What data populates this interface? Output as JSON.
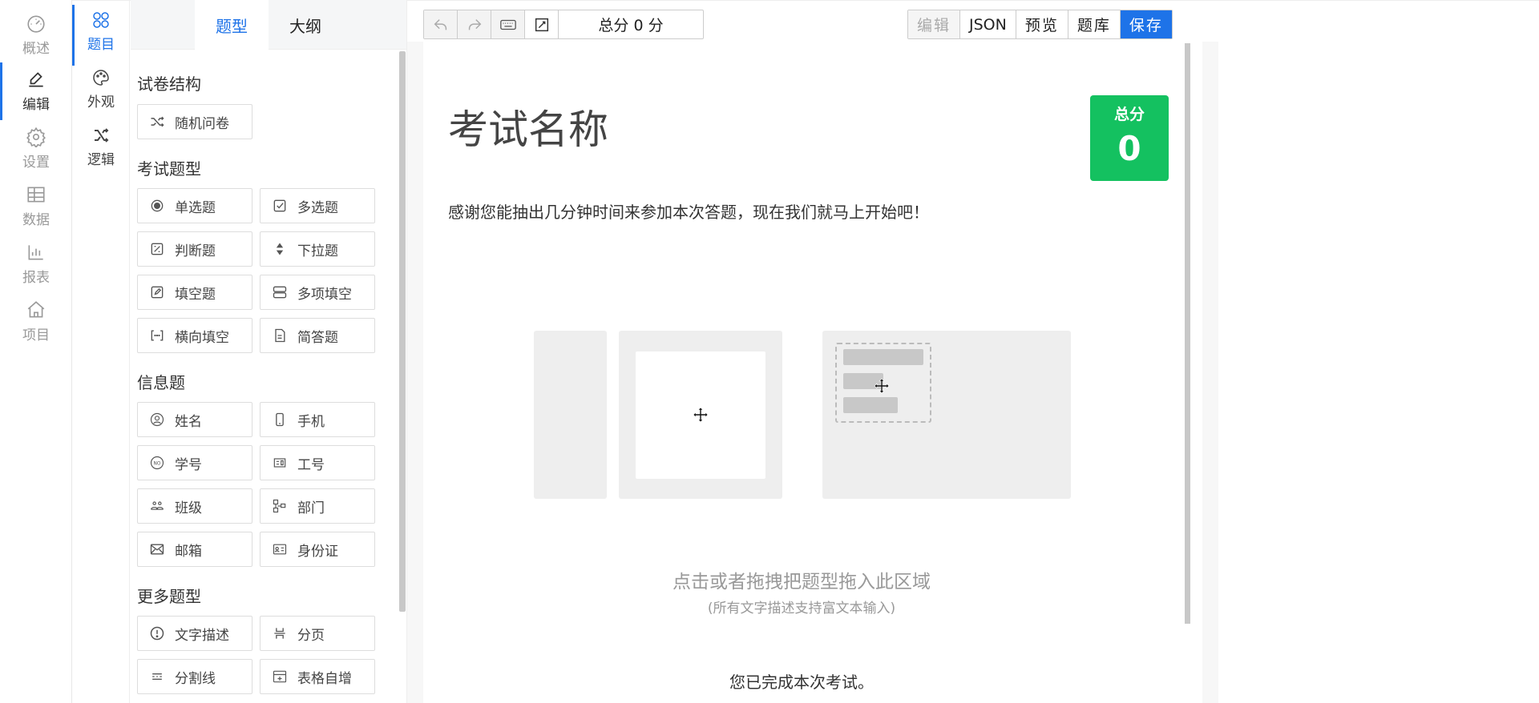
{
  "nav": {
    "items": [
      {
        "label": "概述",
        "icon": "dashboard-icon"
      },
      {
        "label": "编辑",
        "icon": "edit-icon"
      },
      {
        "label": "设置",
        "icon": "gear-icon"
      },
      {
        "label": "数据",
        "icon": "table-icon"
      },
      {
        "label": "报表",
        "icon": "bar-chart-icon"
      },
      {
        "label": "项目",
        "icon": "home-icon"
      }
    ]
  },
  "tools": {
    "items": [
      {
        "label": "题目",
        "icon": "questions-icon"
      },
      {
        "label": "外观",
        "icon": "palette-icon"
      },
      {
        "label": "逻辑",
        "icon": "shuffle-icon"
      }
    ]
  },
  "palette": {
    "tabs": [
      "题型",
      "大纲"
    ],
    "sections": {
      "structure": "试卷结构",
      "exam_types": "考试题型",
      "info": "信息题",
      "more": "更多题型"
    },
    "buttons": {
      "random_paper": "随机问卷",
      "single_choice": "单选题",
      "multi_choice": "多选题",
      "true_false": "判断题",
      "dropdown": "下拉题",
      "fill_blank": "填空题",
      "multi_fill": "多项填空",
      "horizontal_fill": "横向填空",
      "short_answer": "简答题",
      "name": "姓名",
      "phone": "手机",
      "student_id": "学号",
      "employee_id": "工号",
      "class": "班级",
      "department": "部门",
      "email": "邮箱",
      "id_card": "身份证",
      "text_desc": "文字描述",
      "pagination": "分页",
      "divider": "分割线",
      "table_auto": "表格自增"
    }
  },
  "toolbar": {
    "total_score": "总分 0 分",
    "edit": "编辑",
    "json": "JSON",
    "preview": "预览",
    "bank": "题库",
    "save": "保存"
  },
  "exam": {
    "title": "考试名称",
    "score_label": "总分",
    "score_value": "0",
    "intro": "感谢您能抽出几分钟时间来参加本次答题，现在我们就马上开始吧！",
    "drop_hint": "点击或者拖拽把题型拖入此区域",
    "drop_sub": "(所有文字描述支持富文本输入)",
    "finish": "您已完成本次考试。"
  },
  "colors": {
    "accent": "#1e73e8",
    "score_green": "#14c160"
  }
}
